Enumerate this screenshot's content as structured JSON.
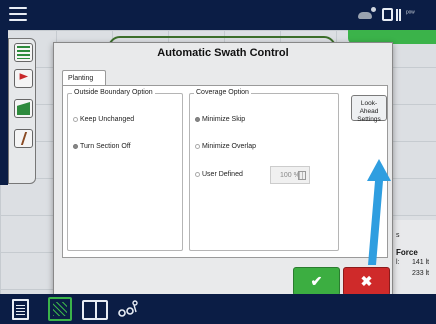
{
  "dialog": {
    "title": "Automatic Swath Control",
    "tab_label": "Planting",
    "outside_boundary": {
      "title": "Outside Boundary Option",
      "options": [
        {
          "label": "Keep Unchanged",
          "selected": false
        },
        {
          "label": "Turn Section Off",
          "selected": true
        }
      ]
    },
    "coverage": {
      "title": "Coverage Option",
      "options": [
        {
          "label": "Minimize Skip",
          "selected": true
        },
        {
          "label": "Minimize Overlap",
          "selected": false
        },
        {
          "label": "User Defined",
          "selected": false
        }
      ],
      "user_defined_value": "100 %"
    },
    "lookahead_label_line1": "Look-Ahead",
    "lookahead_label_line2": "Settings",
    "ok_symbol": "✔",
    "cancel_symbol": "✖"
  },
  "right_panel": {
    "top_text": "s",
    "title": "Force",
    "rows": [
      {
        "label": "l:",
        "value": "141 lt"
      },
      {
        "label": "",
        "value": "233 lt"
      }
    ]
  },
  "colors": {
    "accent_green": "#3cae41",
    "cancel_red": "#cf2a2a",
    "annotation_arrow": "#2f9ee0",
    "nav_bar": "#0b1d45"
  },
  "icons": {
    "top": [
      "menu-icon",
      "gps-icon",
      "status-icons"
    ],
    "left_toolbar": [
      "section-control-icon",
      "flag-icon",
      "field-layer-icon",
      "guidance-icon"
    ],
    "bottom": [
      "document-icon",
      "field-map-icon",
      "split-screen-icon",
      "operator-icon"
    ]
  }
}
